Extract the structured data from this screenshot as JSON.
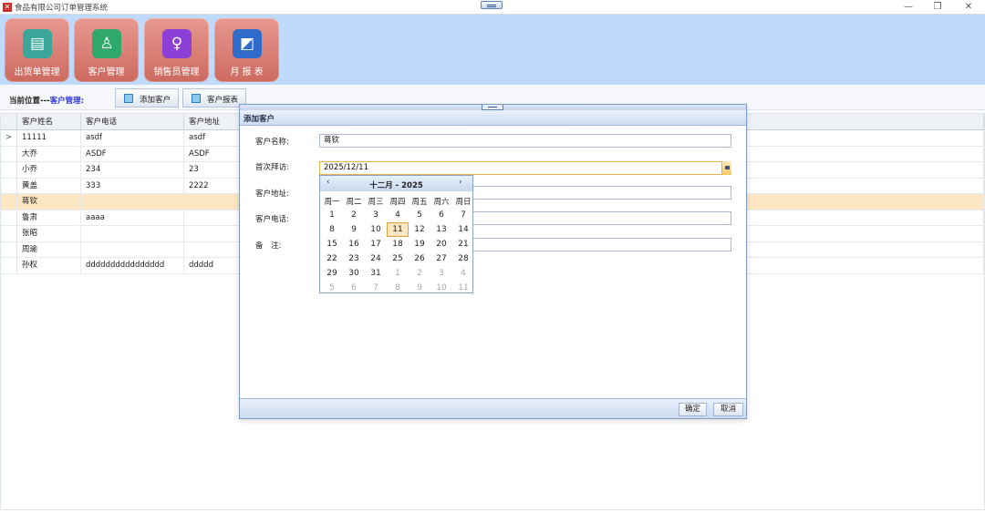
{
  "window": {
    "title": "食品有限公司订单管理系统",
    "icon": "app-logo-icon"
  },
  "toolbar": {
    "buttons": [
      {
        "label": "出货单管理",
        "icon": "document-icon",
        "color": "#3ba79a"
      },
      {
        "label": "客户管理",
        "icon": "user-settings-icon",
        "color": "#2ea86b"
      },
      {
        "label": "销售员管理",
        "icon": "person-icon",
        "color": "#8e3fd6"
      },
      {
        "label": "月 报 表",
        "icon": "chart-icon",
        "color": "#2f6cc9"
      }
    ]
  },
  "breadcrumb": {
    "prefix": "当前位置---",
    "current": "客户管理:"
  },
  "tabs": [
    {
      "label": "添加客户"
    },
    {
      "label": "客户报表"
    }
  ],
  "grid": {
    "columns": [
      "客户姓名",
      "客户电话",
      "客户地址"
    ],
    "current_row_marker": ">",
    "rows": [
      [
        "11111",
        "asdf",
        "asdf"
      ],
      [
        "大乔",
        "ASDF",
        "ASDF"
      ],
      [
        "小乔",
        "234",
        "23"
      ],
      [
        "黄盖",
        "333",
        "2222"
      ],
      [
        "蒋钦",
        "",
        ""
      ],
      [
        "鲁肃",
        "aaaa",
        ""
      ],
      [
        "张昭",
        "",
        ""
      ],
      [
        "周瑜",
        "",
        ""
      ],
      [
        "孙权",
        "dddddddddddddddd",
        "ddddd"
      ]
    ]
  },
  "dialog": {
    "title": "添加客户",
    "fields": {
      "name_label": "客户名称:",
      "name_value": "蒋钦",
      "visit_label": "首次拜访:",
      "visit_value": "2025/12/11",
      "address_label": "客户地址:",
      "phone_label": "客户电话:",
      "note_label": "备　注:"
    },
    "ok_label": "确定",
    "cancel_label": "取消"
  },
  "calendar": {
    "title": "十二月 - 2025",
    "prev": "‹",
    "next": "›",
    "weekdays": [
      "周一",
      "周二",
      "周三",
      "周四",
      "周五",
      "周六",
      "周日"
    ],
    "weeks": [
      [
        "1",
        "2",
        "3",
        "4",
        "5",
        "6",
        "7"
      ],
      [
        "8",
        "9",
        "10",
        "11",
        "12",
        "13",
        "14"
      ],
      [
        "15",
        "16",
        "17",
        "18",
        "19",
        "20",
        "21"
      ],
      [
        "22",
        "23",
        "24",
        "25",
        "26",
        "27",
        "28"
      ],
      [
        "29",
        "30",
        "31",
        "1",
        "2",
        "3",
        "4"
      ],
      [
        "5",
        "6",
        "7",
        "8",
        "9",
        "10",
        "11"
      ]
    ],
    "selected_day": "11"
  }
}
